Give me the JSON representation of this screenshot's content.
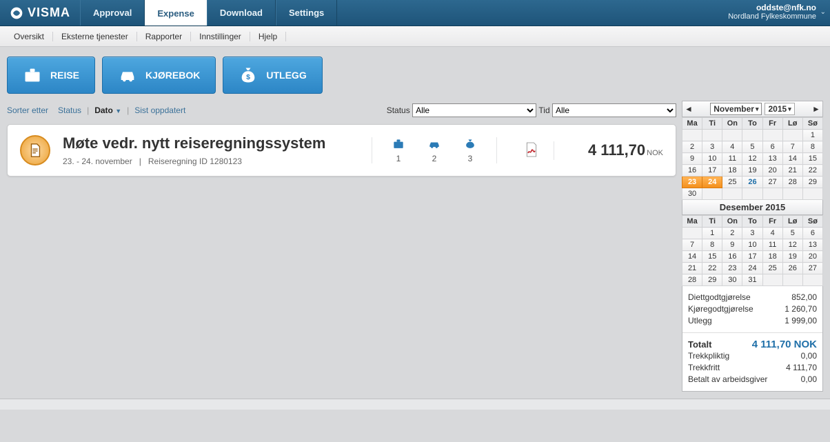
{
  "brand": "VISMA",
  "mainTabs": {
    "approval": "Approval",
    "expense": "Expense",
    "download": "Download",
    "settings": "Settings"
  },
  "user": {
    "email": "oddste@nfk.no",
    "org": "Nordland Fylkeskommune"
  },
  "subnav": {
    "oversikt": "Oversikt",
    "eksterne": "Eksterne tjenester",
    "rapporter": "Rapporter",
    "innstillinger": "Innstillinger",
    "hjelp": "Hjelp"
  },
  "buttons": {
    "reise": "REISE",
    "kjorebok": "KJØREBOK",
    "utlegg": "UTLEGG"
  },
  "filters": {
    "sortLabel": "Sorter etter",
    "status": "Status",
    "dato": "Dato",
    "sist": "Sist oppdatert",
    "statusLabel": "Status",
    "statusValue": "Alle",
    "tidLabel": "Tid",
    "tidValue": "Alle"
  },
  "expense": {
    "title": "Møte vedr. nytt reiseregningssystem",
    "dates": "23. - 24. november",
    "idLabel": "Reiseregning ID 1280123",
    "count1": "1",
    "count2": "2",
    "count3": "3",
    "amount": "4 111,70",
    "currency": "NOK"
  },
  "cal1": {
    "month": "November",
    "year": "2015",
    "dh": [
      "Ma",
      "Ti",
      "On",
      "To",
      "Fr",
      "Lø",
      "Sø"
    ],
    "rows": [
      [
        "",
        "",
        "",
        "",
        "",
        "",
        "1"
      ],
      [
        "2",
        "3",
        "4",
        "5",
        "6",
        "7",
        "8"
      ],
      [
        "9",
        "10",
        "11",
        "12",
        "13",
        "14",
        "15"
      ],
      [
        "16",
        "17",
        "18",
        "19",
        "20",
        "21",
        "22"
      ],
      [
        "23",
        "24",
        "25",
        "26",
        "27",
        "28",
        "29"
      ],
      [
        "30",
        "",
        "",
        "",
        "",
        "",
        ""
      ]
    ],
    "highlighted": [
      "23",
      "24"
    ],
    "today": "26"
  },
  "cal2": {
    "title": "Desember 2015",
    "dh": [
      "Ma",
      "Ti",
      "On",
      "To",
      "Fr",
      "Lø",
      "Sø"
    ],
    "rows": [
      [
        "",
        "1",
        "2",
        "3",
        "4",
        "5",
        "6"
      ],
      [
        "7",
        "8",
        "9",
        "10",
        "11",
        "12",
        "13"
      ],
      [
        "14",
        "15",
        "16",
        "17",
        "18",
        "19",
        "20"
      ],
      [
        "21",
        "22",
        "23",
        "24",
        "25",
        "26",
        "27"
      ],
      [
        "28",
        "29",
        "30",
        "31",
        "",
        "",
        ""
      ]
    ]
  },
  "summary": {
    "diett": {
      "label": "Diettgodtgjørelse",
      "val": "852,00"
    },
    "kjore": {
      "label": "Kjøregodtgjørelse",
      "val": "1 260,70"
    },
    "utlegg": {
      "label": "Utlegg",
      "val": "1 999,00"
    },
    "totalt": {
      "label": "Totalt",
      "val": "4 111,70 NOK"
    },
    "trekkpliktig": {
      "label": "Trekkpliktig",
      "val": "0,00"
    },
    "trekkfritt": {
      "label": "Trekkfritt",
      "val": "4 111,70"
    },
    "betalt": {
      "label": "Betalt av arbeidsgiver",
      "val": "0,00"
    }
  }
}
